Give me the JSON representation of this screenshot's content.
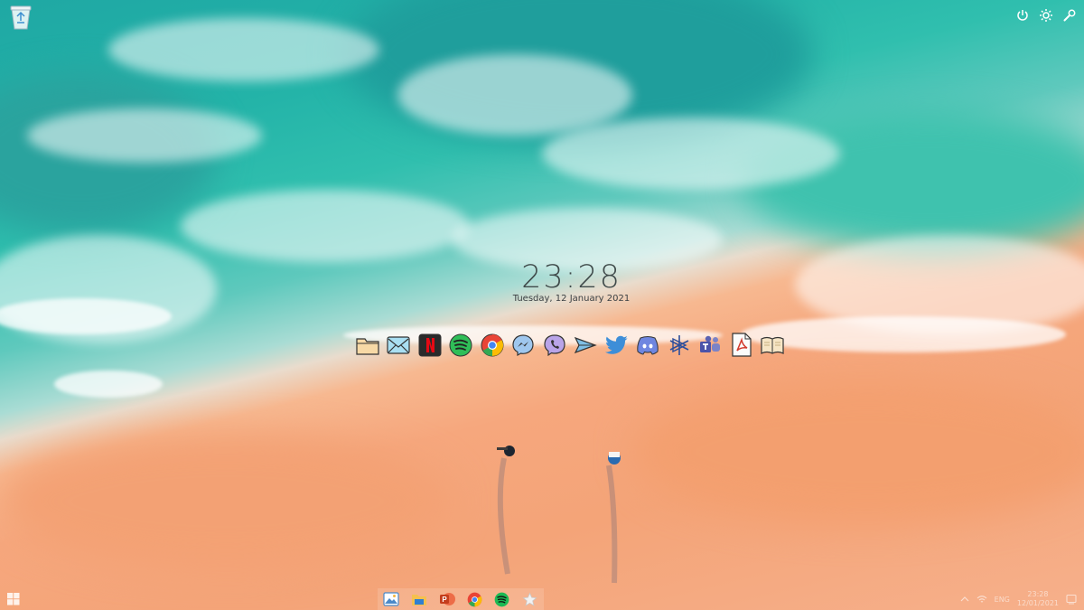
{
  "desktop": {
    "icons": [
      {
        "name": "Recycle Bin",
        "icon": "recycle-bin-icon"
      }
    ]
  },
  "clock_widget": {
    "time": "23:28",
    "date": "Tuesday, 12 January 2021"
  },
  "top_tools": [
    {
      "icon": "power-icon"
    },
    {
      "icon": "settings-icon"
    },
    {
      "icon": "wrench-icon"
    }
  ],
  "dock": [
    {
      "app": "File Explorer",
      "icon": "folder-icon"
    },
    {
      "app": "Mail",
      "icon": "mail-icon"
    },
    {
      "app": "Netflix",
      "icon": "netflix-icon"
    },
    {
      "app": "Spotify",
      "icon": "spotify-icon"
    },
    {
      "app": "Google Chrome",
      "icon": "chrome-icon"
    },
    {
      "app": "Messenger",
      "icon": "messenger-icon"
    },
    {
      "app": "Viber",
      "icon": "viber-icon"
    },
    {
      "app": "Send",
      "icon": "send-icon"
    },
    {
      "app": "Twitter",
      "icon": "twitter-icon"
    },
    {
      "app": "Discord",
      "icon": "discord-icon"
    },
    {
      "app": "Visual Studio",
      "icon": "vs-icon"
    },
    {
      "app": "Microsoft Teams",
      "icon": "teams-icon"
    },
    {
      "app": "Adobe Acrobat",
      "icon": "pdf-icon"
    },
    {
      "app": "Book Reader",
      "icon": "book-icon"
    }
  ],
  "taskbar": {
    "start_icon": "windows-start-icon",
    "apps": [
      {
        "app": "Photos",
        "icon": "photos-icon"
      },
      {
        "app": "File Explorer",
        "icon": "file-explorer-icon"
      },
      {
        "app": "PowerPoint",
        "icon": "powerpoint-icon"
      },
      {
        "app": "Google Chrome",
        "icon": "chrome-icon"
      },
      {
        "app": "Spotify",
        "icon": "spotify-icon"
      },
      {
        "app": "Star",
        "icon": "star-icon"
      }
    ],
    "tray": {
      "language": "ENG",
      "time": "23:28",
      "date": "12/01/2021"
    }
  },
  "colors": {
    "sea": "#23b3a8",
    "sand": "#f4a478",
    "clock_text": "#3f4a4a"
  }
}
